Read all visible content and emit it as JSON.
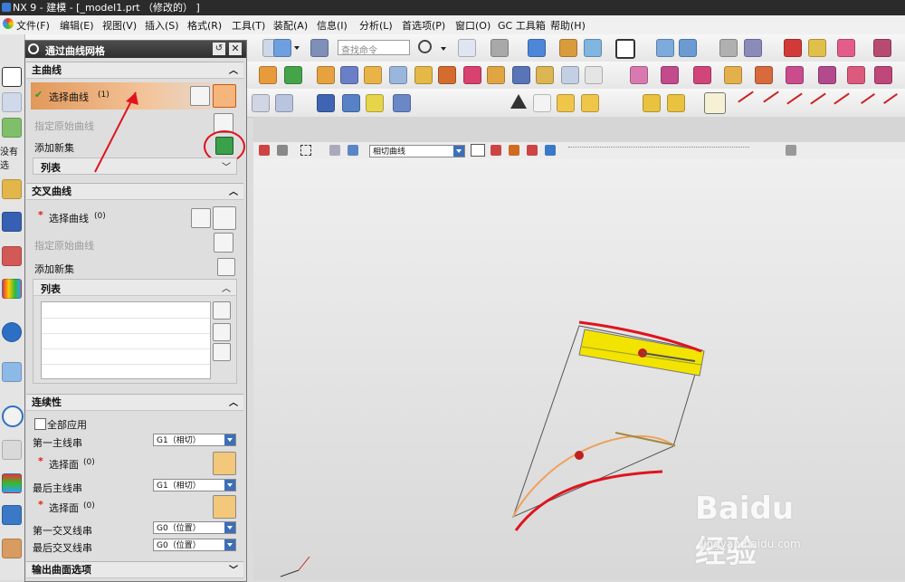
{
  "window": {
    "title": "NX 9 - 建模 - [_model1.prt （修改的） ]"
  },
  "menu": [
    "文件(F)",
    "编辑(E)",
    "视图(V)",
    "插入(S)",
    "格式(R)",
    "工具(T)",
    "装配(A)",
    "信息(I)",
    "分析(L)",
    "首选项(P)",
    "窗口(O)",
    "GC 工具箱",
    "帮助(H)"
  ],
  "toolbar": {
    "command_search_placeholder": "查找命令",
    "curve_rule": "相切曲线"
  },
  "side_strip": {
    "label": "没有选"
  },
  "dialog": {
    "title": "通过曲线网格",
    "primary_section": {
      "title": "主曲线",
      "select_curve": "选择曲线",
      "select_curve_count": "(1)",
      "specify_origin": "指定原始曲线",
      "add_new_set": "添加新集",
      "list": "列表"
    },
    "cross_section": {
      "title": "交叉曲线",
      "select_curve": "选择曲线",
      "select_curve_count": "(0)",
      "specify_origin": "指定原始曲线",
      "add_new_set": "添加新集",
      "list": "列表"
    },
    "continuity": {
      "title": "连续性",
      "apply_all": "全部应用",
      "first_primary": "第一主线串",
      "first_primary_value": "G1（相切）",
      "select_face_1": "选择面",
      "select_face_1_count": "(0)",
      "last_primary": "最后主线串",
      "last_primary_value": "G1（相切）",
      "select_face_2": "选择面",
      "select_face_2_count": "(0)",
      "first_cross": "第一交叉线串",
      "first_cross_value": "G0（位置）",
      "last_cross": "最后交叉线串",
      "last_cross_value": "G0（位置）"
    },
    "output_section": {
      "title": "输出曲面选项"
    }
  },
  "watermark": {
    "brand": "Baidu经验",
    "url": "jingyan.baidu.com"
  },
  "colors": {
    "annotation_red": "#e0141e",
    "highlight_orange": "#f0a15d",
    "surface_yellow": "#f2e400"
  }
}
